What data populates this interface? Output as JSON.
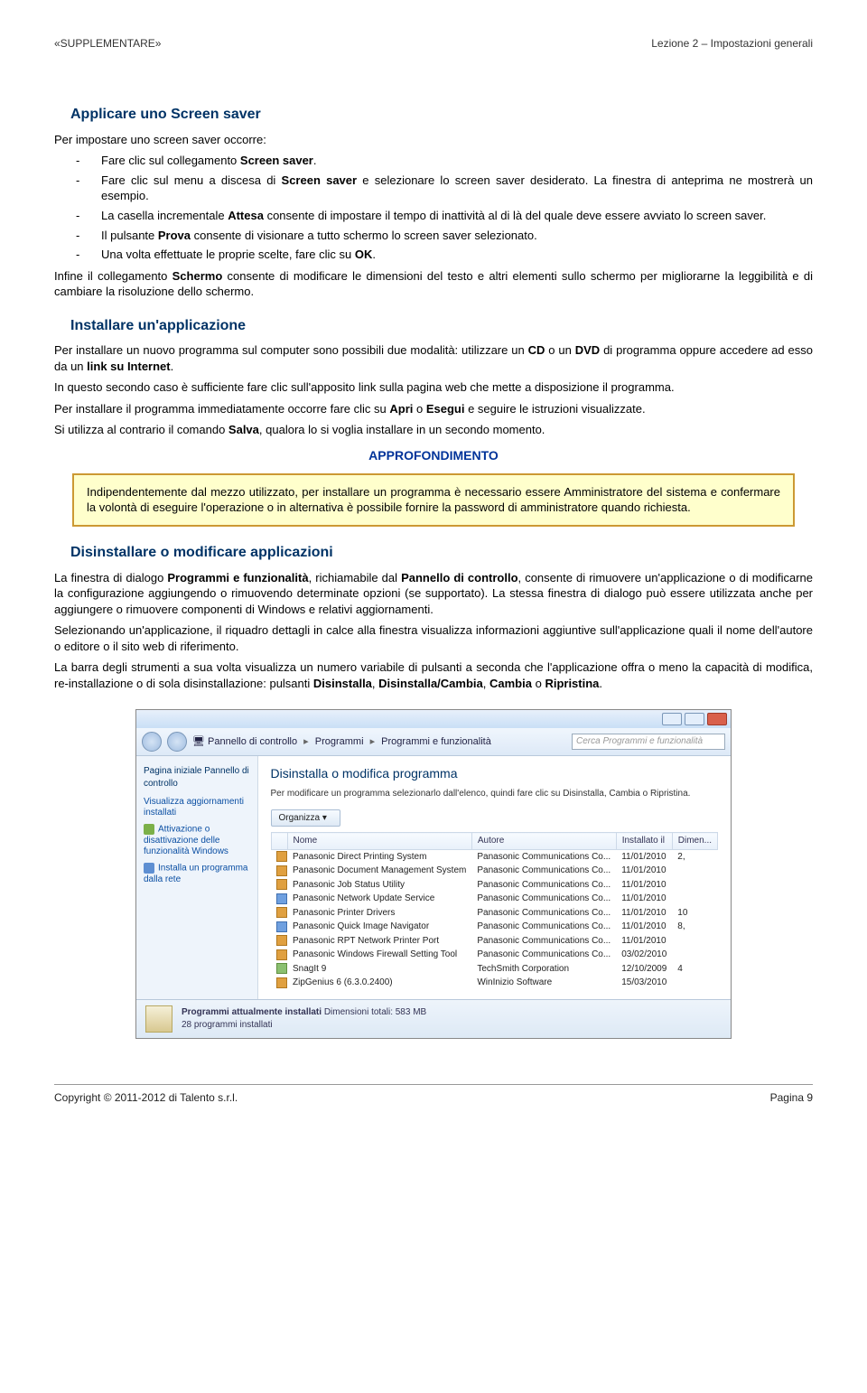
{
  "header": {
    "left": "«SUPPLEMENTARE»",
    "right": "Lezione 2 – Impostazioni generali"
  },
  "section1": {
    "title": "Applicare uno Screen saver",
    "intro": "Per impostare uno screen saver occorre:",
    "bullets": [
      "Fare clic sul collegamento <b>Screen saver</b>.",
      "Fare clic sul menu a discesa di <b>Screen saver</b> e selezionare lo screen saver desiderato. La finestra di anteprima ne mostrerà un esempio.",
      "La casella incrementale <b>Attesa</b> consente di impostare il tempo di inattività al di là del quale deve essere avviato lo screen saver.",
      "Il pulsante <b>Prova</b> consente di visionare a tutto schermo lo screen saver selezionato.",
      "Una volta effettuate le proprie scelte, fare clic su <b>OK</b>."
    ],
    "after": "Infine il collegamento <b>Schermo</b> consente di modificare le dimensioni del testo e altri elementi sullo schermo per migliorarne la leggibilità e di cambiare la risoluzione dello schermo."
  },
  "section2": {
    "title": "Installare un'applicazione",
    "p1": "Per installare un nuovo programma sul computer sono possibili due modalità: utilizzare un <b>CD</b> o un <b>DVD</b> di programma oppure accedere ad esso da un <b>link su Internet</b>.",
    "p2": "In questo secondo caso è sufficiente fare clic sull'apposito link sulla pagina web che mette a disposizione il programma.",
    "p3": "Per installare il programma immediatamente occorre fare clic su <b>Apri</b> o <b>Esegui</b> e seguire le istruzioni visualizzate.",
    "p4": "Si utilizza al contrario il comando <b>Salva</b>, qualora lo si voglia installare in un secondo momento.",
    "approf_title": "APPROFONDIMENTO",
    "approf_text": "Indipendentemente dal mezzo utilizzato, per installare un programma è necessario essere Amministratore del sistema e confermare la volontà di eseguire l'operazione o in alternativa è possibile fornire la password di amministratore quando richiesta."
  },
  "section3": {
    "title": "Disinstallare o modificare applicazioni",
    "p1": "La finestra di dialogo <b>Programmi e funzionalità</b>, richiamabile dal <b>Pannello di controllo</b>, consente di rimuovere un'applicazione o di modificarne la configurazione aggiungendo o rimuovendo determinate opzioni (se supportato). La stessa finestra di dialogo può essere utilizzata anche per aggiungere o rimuovere componenti di Windows e relativi aggiornamenti.",
    "p2": "Selezionando un'applicazione, il riquadro dettagli in calce alla finestra visualizza informazioni aggiuntive sull'applicazione quali il nome dell'autore o editore o il sito web di riferimento.",
    "p3": "La barra degli strumenti a sua volta visualizza un numero variabile di pulsanti a seconda che l'applicazione offra o meno la capacità di modifica, re-installazione o di sola disinstallazione: pulsanti <b>Disinstalla</b>, <b>Disinstalla/Cambia</b>, <b>Cambia</b> o <b>Ripristina</b>."
  },
  "screenshot": {
    "breadcrumb": [
      "Pannello di controllo",
      "Programmi",
      "Programmi e funzionalità"
    ],
    "search_placeholder": "Cerca Programmi e funzionalità",
    "side": {
      "header": "Pagina iniziale Pannello di controllo",
      "links": [
        "Visualizza aggiornamenti installati",
        "Attivazione o disattivazione delle funzionalità Windows",
        "Installa un programma dalla rete"
      ]
    },
    "content": {
      "title": "Disinstalla o modifica programma",
      "sub": "Per modificare un programma selezionarlo dall'elenco, quindi fare clic su Disinstalla, Cambia o Ripristina.",
      "organize": "Organizza ▾"
    },
    "columns": [
      "Nome",
      "Autore",
      "Installato il",
      "Dimen..."
    ],
    "rows": [
      {
        "ico": "o",
        "name": "Panasonic Direct Printing System",
        "author": "Panasonic Communications Co...",
        "date": "11/01/2010",
        "size": "2,"
      },
      {
        "ico": "o",
        "name": "Panasonic Document Management System",
        "author": "Panasonic Communications Co...",
        "date": "11/01/2010",
        "size": ""
      },
      {
        "ico": "o",
        "name": "Panasonic Job Status Utility",
        "author": "Panasonic Communications Co...",
        "date": "11/01/2010",
        "size": ""
      },
      {
        "ico": "b",
        "name": "Panasonic Network Update Service",
        "author": "Panasonic Communications Co...",
        "date": "11/01/2010",
        "size": ""
      },
      {
        "ico": "o",
        "name": "Panasonic Printer Drivers",
        "author": "Panasonic Communications Co...",
        "date": "11/01/2010",
        "size": "10"
      },
      {
        "ico": "b",
        "name": "Panasonic Quick Image Navigator",
        "author": "Panasonic Communications Co...",
        "date": "11/01/2010",
        "size": "8,"
      },
      {
        "ico": "o",
        "name": "Panasonic RPT Network Printer Port",
        "author": "Panasonic Communications Co...",
        "date": "11/01/2010",
        "size": ""
      },
      {
        "ico": "o",
        "name": "Panasonic Windows Firewall Setting Tool",
        "author": "Panasonic Communications Co...",
        "date": "03/02/2010",
        "size": ""
      },
      {
        "ico": "g",
        "name": "SnagIt 9",
        "author": "TechSmith Corporation",
        "date": "12/10/2009",
        "size": "4"
      },
      {
        "ico": "o",
        "name": "ZipGenius 6 (6.3.0.2400)",
        "author": "WinInizio Software",
        "date": "15/03/2010",
        "size": ""
      }
    ],
    "status": {
      "line1_label": "Programmi attualmente installati",
      "line1_value": "Dimensioni totali: 583 MB",
      "line2": "28 programmi installati"
    }
  },
  "footer": {
    "left": "Copyright © 2011-2012 di Talento s.r.l.",
    "right": "Pagina 9"
  }
}
